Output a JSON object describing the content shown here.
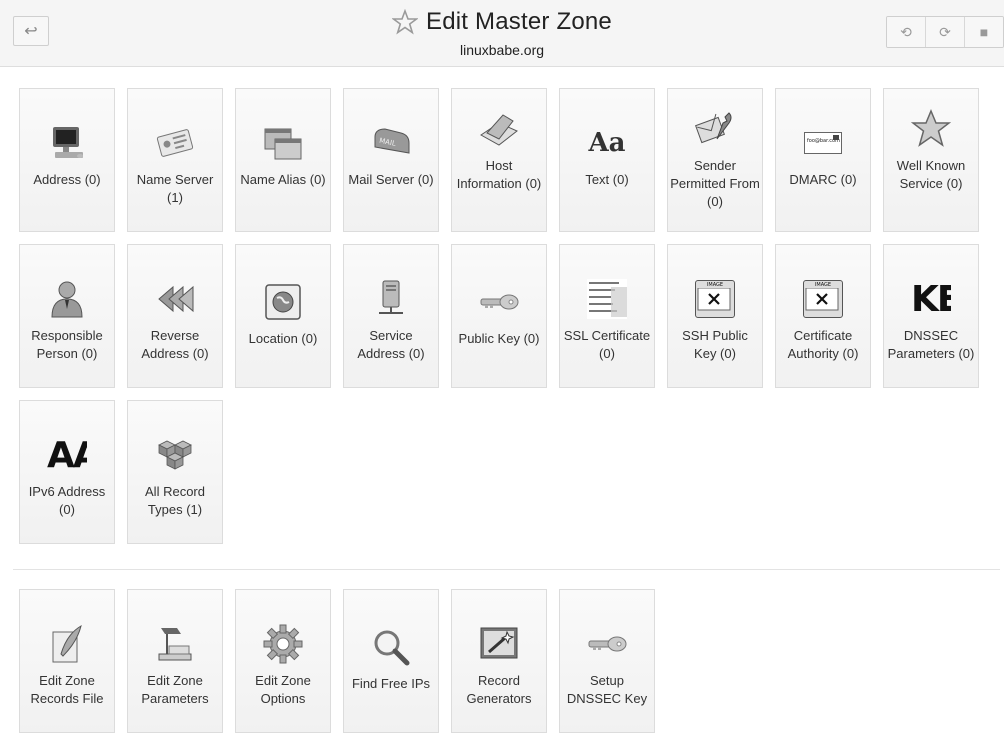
{
  "header": {
    "title": "Edit Master Zone",
    "subtitle": "linuxbabe.org",
    "back_symbol": "↩",
    "tools": [
      "⟲",
      "⟳",
      "■"
    ]
  },
  "records": [
    {
      "label": "Address (0)",
      "icon": "computer-icon"
    },
    {
      "label": "Name Server (1)",
      "icon": "id-card-icon"
    },
    {
      "label": "Name Alias (0)",
      "icon": "windows-icon"
    },
    {
      "label": "Mail Server (0)",
      "icon": "mailbox-icon"
    },
    {
      "label": "Host Information (0)",
      "icon": "book-icon"
    },
    {
      "label": "Text (0)",
      "icon": "text-aa-icon",
      "text": "Aa"
    },
    {
      "label": "Sender Permitted From (0)",
      "icon": "mail-wrench-icon"
    },
    {
      "label": "DMARC (0)",
      "icon": "email-card-icon",
      "text": "foo@bar.com"
    },
    {
      "label": "Well Known Service (0)",
      "icon": "star-icon"
    },
    {
      "label": "Responsible Person (0)",
      "icon": "person-icon"
    },
    {
      "label": "Reverse Address (0)",
      "icon": "rewind-icon"
    },
    {
      "label": "Location (0)",
      "icon": "globe-icon"
    },
    {
      "label": "Service Address (0)",
      "icon": "server-icon"
    },
    {
      "label": "Public Key (0)",
      "icon": "key-icon"
    },
    {
      "label": "SSL Certificate (0)",
      "icon": "certificate-icon"
    },
    {
      "label": "SSH Public Key (0)",
      "icon": "image-not-found-icon",
      "text": "IMAGE"
    },
    {
      "label": "Certificate Authority (0)",
      "icon": "image-not-found-icon",
      "text": "IMAGE"
    },
    {
      "label": "DNSSEC Parameters (0)",
      "icon": "ke-text-icon",
      "text": "KE"
    },
    {
      "label": "IPv6 Address (0)",
      "icon": "aa-text-icon",
      "text": "AA"
    },
    {
      "label": "All Record Types (1)",
      "icon": "cubes-icon"
    }
  ],
  "actions": [
    {
      "label": "Edit Zone Records File",
      "icon": "quill-icon"
    },
    {
      "label": "Edit Zone Parameters",
      "icon": "lamp-icon"
    },
    {
      "label": "Edit Zone Options",
      "icon": "gear-icon"
    },
    {
      "label": "Find Free IPs",
      "icon": "magnifier-icon"
    },
    {
      "label": "Record Generators",
      "icon": "wand-icon"
    },
    {
      "label": "Setup DNSSEC Key",
      "icon": "key-icon"
    }
  ]
}
